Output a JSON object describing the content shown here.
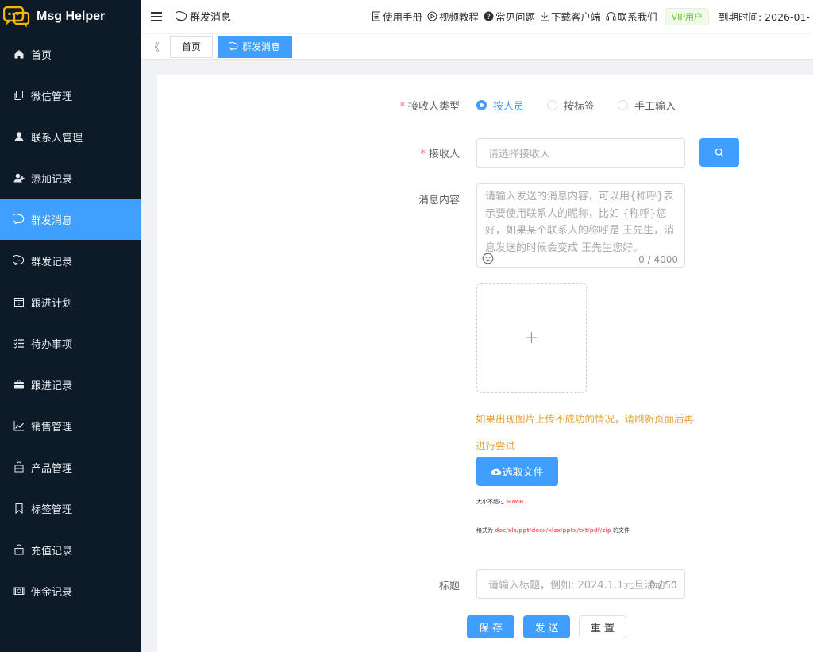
{
  "app": {
    "name": "Msg Helper"
  },
  "sidebar": {
    "items": [
      {
        "label": "首页",
        "icon": "home-icon"
      },
      {
        "label": "微信管理",
        "icon": "copy-icon"
      },
      {
        "label": "联系人管理",
        "icon": "user-icon"
      },
      {
        "label": "添加记录",
        "icon": "user-add-icon"
      },
      {
        "label": "群发消息",
        "icon": "chat-bubble-icon",
        "active": true
      },
      {
        "label": "群发记录",
        "icon": "chat-dots-icon"
      },
      {
        "label": "跟进计划",
        "icon": "calendar-icon"
      },
      {
        "label": "待办事项",
        "icon": "checklist-icon"
      },
      {
        "label": "跟进记录",
        "icon": "briefcase-icon"
      },
      {
        "label": "销售管理",
        "icon": "chart-line-icon"
      },
      {
        "label": "产品管理",
        "icon": "shopping-bag-icon"
      },
      {
        "label": "标签管理",
        "icon": "bookmark-icon"
      },
      {
        "label": "充值记录",
        "icon": "handbag-icon"
      },
      {
        "label": "佣金记录",
        "icon": "money-icon"
      }
    ]
  },
  "header": {
    "breadcrumb": "群发消息",
    "links": [
      "使用手册",
      "视频教程",
      "常见问题",
      "下载客户端",
      "联系我们"
    ],
    "vip": "VIP用户",
    "expire": "到期时间: 2026-01-"
  },
  "tabs": [
    {
      "label": "首页"
    },
    {
      "label": "群发消息",
      "active": true
    }
  ],
  "form": {
    "receiver_type_label": "接收人类型",
    "receiver_types": [
      "按人员",
      "按标签",
      "手工输入"
    ],
    "receiver_label": "接收人",
    "receiver_placeholder": "请选择接收人",
    "content_label": "消息内容",
    "content_placeholder": "请输入发送的消息内容，可以用{称呼}表示要使用联系人的昵称，比如 {称呼}您好，如果某个联系人的称呼是 王先生，消息发送的时候会变成 王先生您好。",
    "content_count": "0 / 4000",
    "upload_plus": "+",
    "warning": "如果出现图片上传不成功的情况，请刷新页面后再进行尝试",
    "select_file": "选取文件",
    "size_prefix": "大小不超过",
    "size_value": "60MB",
    "format_prefix": "格式为",
    "format_value": "doc/xls/ppt/docx/xlsx/pptx/txt/pdf/zip",
    "format_suffix": "的文件",
    "title_label": "标题",
    "title_placeholder": "请输入标题，例如: 2024.1.1元旦活动",
    "title_count": "0 / 50",
    "save": "保 存",
    "send": "发 送",
    "reset": "重 置"
  },
  "colors": {
    "primary": "#409eff",
    "sidebar": "#0d1a28",
    "warning": "#e6a23c",
    "danger": "#f56c6c"
  }
}
